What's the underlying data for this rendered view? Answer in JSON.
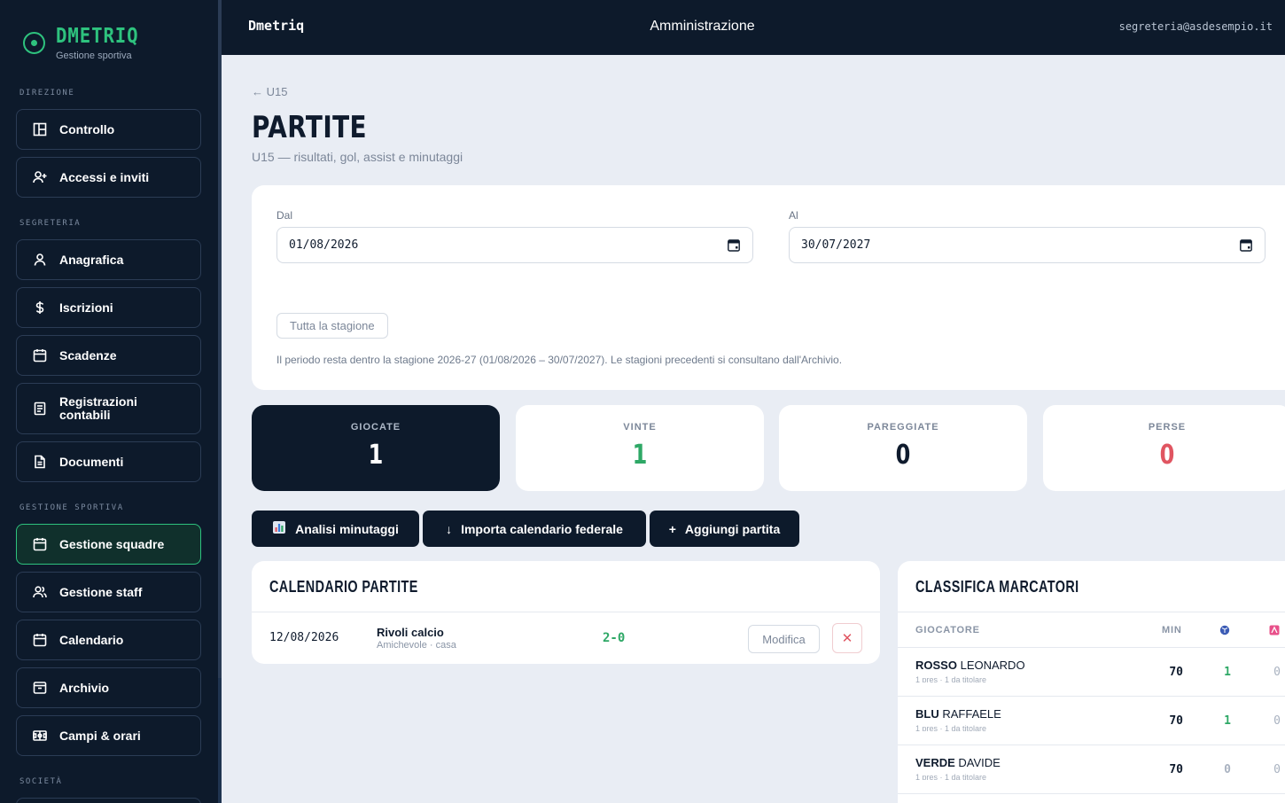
{
  "brand": {
    "name": "DMETRIQ",
    "subtitle": "Gestione sportiva"
  },
  "sidebar": {
    "sections": [
      "DIREZIONE",
      "SEGRETERIA",
      "GESTIONE SPORTIVA",
      "SOCIETÀ"
    ],
    "items": [
      {
        "label": "Controllo",
        "icon": "dashboard-icon"
      },
      {
        "label": "Accessi e inviti",
        "icon": "user-plus-icon"
      },
      {
        "label": "Anagrafica",
        "icon": "user-icon"
      },
      {
        "label": "Iscrizioni",
        "icon": "dollar-icon"
      },
      {
        "label": "Scadenze",
        "icon": "calendar-icon"
      },
      {
        "label": "Registrazioni contabili",
        "icon": "ledger-icon"
      },
      {
        "label": "Documenti",
        "icon": "document-icon"
      },
      {
        "label": "Gestione squadre",
        "icon": "calendar-icon",
        "active": true
      },
      {
        "label": "Gestione staff",
        "icon": "users-icon"
      },
      {
        "label": "Calendario",
        "icon": "calendar-icon"
      },
      {
        "label": "Archivio",
        "icon": "archive-icon"
      },
      {
        "label": "Campi & orari",
        "icon": "field-icon"
      }
    ]
  },
  "topbar": {
    "brand": "Dmetriq",
    "title": "Amministrazione",
    "email": "segreteria@asdesempio.it"
  },
  "page": {
    "back": "← U15",
    "title": "PARTITE",
    "subtitle": "U15 — risultati, gol, assist e minutaggi"
  },
  "filter": {
    "from_label": "Dal",
    "from_value": "01/08/2026",
    "to_label": "Al",
    "to_value": "30/07/2027",
    "season_button": "Tutta la stagione",
    "note": "Il periodo resta dentro la stagione 2026-27 (01/08/2026 – 30/07/2027). Le stagioni precedenti si consultano dall'Archivio."
  },
  "stats": [
    {
      "label": "GIOCATE",
      "value": "1",
      "color": "#ffffff"
    },
    {
      "label": "VINTE",
      "value": "1",
      "color": "#2ea866"
    },
    {
      "label": "PAREGGIATE",
      "value": "0",
      "color": "#0f1b2d"
    },
    {
      "label": "PERSE",
      "value": "0",
      "color": "#e05561"
    }
  ],
  "actions": {
    "minutes": "Analisi minutaggi",
    "import": "Importa calendario federale",
    "add": "Aggiungi partita"
  },
  "calendar": {
    "title": "CALENDARIO PARTITE",
    "matches": [
      {
        "date": "12/08/2026",
        "opponent": "Rivoli calcio",
        "meta": "Amichevole · casa",
        "score": "2-0",
        "edit": "Modifica",
        "delete": "✕"
      }
    ]
  },
  "scorers": {
    "title": "CLASSIFICA MARCATORI",
    "headers": {
      "player": "GIOCATORE",
      "min": "MIN"
    },
    "rows": [
      {
        "last": "ROSSO",
        "first": "LEONARDO",
        "sub": "1 pres · 1 da titolare",
        "min": "70",
        "goals": "1",
        "assists": "0"
      },
      {
        "last": "BLU",
        "first": "RAFFAELE",
        "sub": "1 pres · 1 da titolare",
        "min": "70",
        "goals": "1",
        "assists": "0"
      },
      {
        "last": "VERDE",
        "first": "DAVIDE",
        "sub": "1 pres · 1 da titolare",
        "min": "70",
        "goals": "0",
        "assists": "0"
      }
    ]
  }
}
